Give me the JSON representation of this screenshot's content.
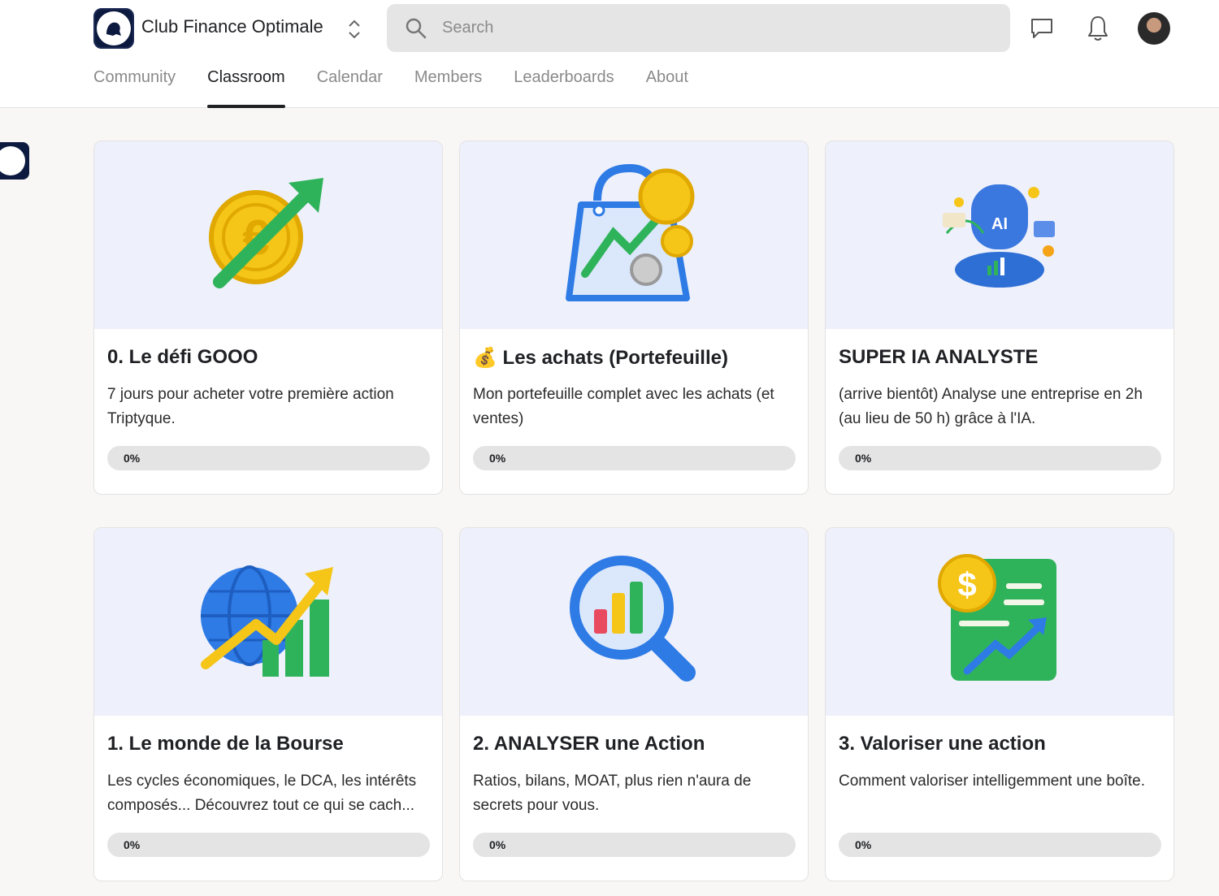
{
  "header": {
    "club_name": "Club Finance Optimale",
    "search_placeholder": "Search"
  },
  "tabs": [
    {
      "label": "Community",
      "active": false
    },
    {
      "label": "Classroom",
      "active": true
    },
    {
      "label": "Calendar",
      "active": false
    },
    {
      "label": "Members",
      "active": false
    },
    {
      "label": "Leaderboards",
      "active": false
    },
    {
      "label": "About",
      "active": false
    }
  ],
  "courses": [
    {
      "title": "0. Le défi GOOO",
      "description": "7 jours pour acheter votre première action Triptyque.",
      "progress": 0,
      "progress_label": "0%",
      "icon": "euro-coin-arrow-icon"
    },
    {
      "title": "💰 Les achats (Portefeuille)",
      "description": "Mon portefeuille complet avec les achats (et ventes)",
      "progress": 0,
      "progress_label": "0%",
      "icon": "shopping-bag-chart-icon"
    },
    {
      "title": "SUPER IA ANALYSTE",
      "description": "(arrive bientôt) Analyse une entreprise en 2h (au lieu de 50 h) grâce à l'IA.",
      "progress": 0,
      "progress_label": "0%",
      "icon": "ai-robot-icon"
    },
    {
      "title": "1. Le monde de la Bourse",
      "description": "Les cycles économiques, le DCA, les intérêts composés... Découvrez tout ce qui se cach...",
      "progress": 0,
      "progress_label": "0%",
      "icon": "globe-chart-icon"
    },
    {
      "title": "2. ANALYSER une Action",
      "description": "Ratios, bilans, MOAT, plus rien n'aura de secrets pour vous.",
      "progress": 0,
      "progress_label": "0%",
      "icon": "magnifier-chart-icon"
    },
    {
      "title": "3. Valoriser une action",
      "description": "Comment valoriser intelligemment une boîte.",
      "progress": 0,
      "progress_label": "0%",
      "icon": "dollar-document-icon"
    }
  ],
  "colors": {
    "accent": "#202124",
    "card_image_bg": "#eef0fb",
    "progress_track": "#e4e4e4"
  }
}
